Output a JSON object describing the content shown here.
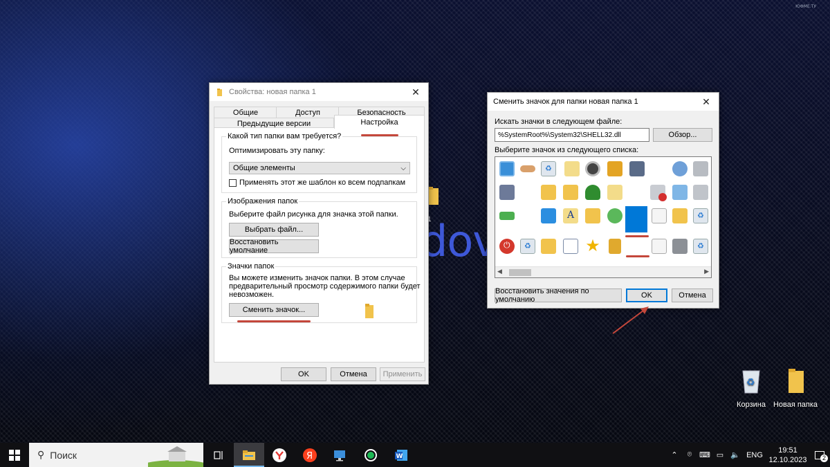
{
  "desktop": {
    "watermark": "ЮФМЕ.ТУ",
    "bg_brand_fragment": "dov",
    "bg_folder_label": "1",
    "icons": [
      {
        "label": "Корзина",
        "icon": "recycle-bin-icon"
      },
      {
        "label": "Новая папка",
        "icon": "folder-icon"
      }
    ]
  },
  "properties": {
    "title": "Свойства: новая папка 1",
    "tabs": {
      "row1": [
        "Общие",
        "Доступ",
        "Безопасность"
      ],
      "row2": [
        "Предыдущие версии",
        "Настройка"
      ],
      "active": "Настройка"
    },
    "folder_type": {
      "title": "Какой тип папки вам требуется?",
      "optimize_label": "Оптимизировать эту папку:",
      "selected": "Общие элементы",
      "apply_template": "Применять этот же шаблон ко всем подпапкам"
    },
    "folder_pictures": {
      "title": "Изображения папок",
      "description": "Выберите файл рисунка для значка этой папки.",
      "choose_file": "Выбрать файл...",
      "restore_default": "Восстановить умолчание"
    },
    "folder_icons": {
      "title": "Значки папок",
      "description_lines": [
        "Вы можете изменить значок папки. В этом случае",
        "предварительный просмотр содержимого папки будет",
        "невозможен."
      ],
      "change_icon": "Сменить значок..."
    },
    "buttons": {
      "ok": "OK",
      "cancel": "Отмена",
      "apply": "Применить"
    }
  },
  "change_icon": {
    "title": "Сменить значок для папки новая папка 1",
    "search_label": "Искать значки в следующем файле:",
    "file_path": "%SystemRoot%\\System32\\SHELL32.dll",
    "browse": "Обзор...",
    "list_label": "Выберите значок из следующего списка:",
    "restore_defaults": "Восстановить значения по умолчанию",
    "ok": "OK",
    "cancel": "Отмена",
    "icon_grid": [
      [
        "monitor-icon",
        "hand-icon",
        "recycle-bin-icon",
        "document-grid-icon",
        "cd-drive-icon",
        "search-key-icon",
        "window-gear-icon",
        "",
        "network-globe-icon",
        "printer-icon"
      ],
      [
        "computer-shortcut-icon",
        "",
        "folder-tools-icon",
        "folder-printer-icon",
        "tree-icon",
        "folder-up-arrow-icon",
        "",
        "error-drive-icon",
        "control-panel-icon",
        "printer-stack-icon"
      ],
      [
        "arrow-drive-icon",
        "",
        "monitor-blue-icon",
        "folder-font-icon",
        "folder-monitor-icon",
        "sync-arrows-icon",
        "blank-selected-icon",
        "pages-icon",
        "folder-print-icon",
        "recycle-bin-icon"
      ],
      [
        "power-icon",
        "recycle-bin-icon",
        "folder-tools-icon",
        "checklist-icon",
        "star-icon",
        "lock-icon",
        "",
        "magnifier-icon",
        "printer-arrow-icon",
        "recycle-bin-icon"
      ]
    ]
  },
  "taskbar": {
    "search_placeholder": "Поиск",
    "apps": [
      "start-icon",
      "task-view-icon",
      "file-explorer-icon",
      "yandex-browser-icon",
      "yandex-icon",
      "remote-desktop-icon",
      "green-circle-icon",
      "word-icon"
    ],
    "language": "ENG",
    "time": "19:51",
    "date": "12.10.2023",
    "notifications": "2"
  },
  "colors": {
    "accent": "#0078d7",
    "annotation_red": "#c4473b"
  }
}
